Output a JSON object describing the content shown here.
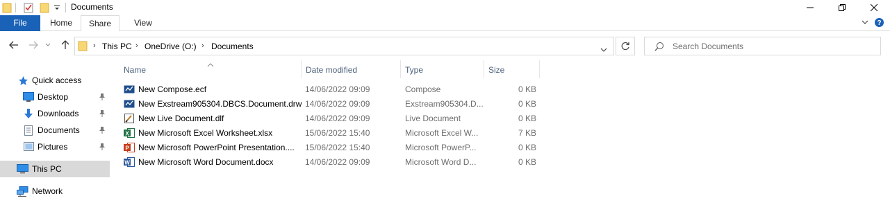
{
  "window": {
    "title": "Documents",
    "controls": {
      "minimize": "—",
      "maximize": "❐",
      "close": "✕"
    }
  },
  "ribbon": {
    "tabs": [
      "File",
      "Home",
      "Share",
      "View"
    ],
    "active_tab": "Share",
    "file_tab_color": "#1a62b8"
  },
  "address": {
    "segments": [
      "This PC",
      "OneDrive (O:)",
      "Documents"
    ],
    "search_placeholder": "Search Documents"
  },
  "sidebar": {
    "items": [
      {
        "label": "Quick access",
        "icon": "star-icon"
      },
      {
        "label": "Desktop",
        "icon": "desktop-icon",
        "pinned": true
      },
      {
        "label": "Downloads",
        "icon": "download-icon",
        "pinned": true
      },
      {
        "label": "Documents",
        "icon": "documents-icon",
        "pinned": true
      },
      {
        "label": "Pictures",
        "icon": "pictures-icon",
        "pinned": true
      },
      {
        "label": "This PC",
        "icon": "computer-icon",
        "selected": true
      },
      {
        "label": "Network",
        "icon": "network-icon"
      }
    ]
  },
  "columns": [
    "Name",
    "Date modified",
    "Type",
    "Size"
  ],
  "files": [
    {
      "name": "New Compose.ecf",
      "date": "14/06/2022 09:09",
      "type": "Compose",
      "size": "0 KB",
      "icon": "exstream-icon"
    },
    {
      "name": "New Exstream905304.DBCS.Document.drw",
      "date": "14/06/2022 09:09",
      "type": "Exstream905304.D...",
      "size": "0 KB",
      "icon": "exstream-icon"
    },
    {
      "name": "New Live Document.dlf",
      "date": "14/06/2022 09:09",
      "type": "Live Document",
      "size": "0 KB",
      "icon": "live-document-icon"
    },
    {
      "name": "New Microsoft Excel Worksheet.xlsx",
      "date": "15/06/2022 15:40",
      "type": "Microsoft Excel W...",
      "size": "7 KB",
      "icon": "excel-icon"
    },
    {
      "name": "New Microsoft PowerPoint Presentation....",
      "date": "15/06/2022 15:40",
      "type": "Microsoft PowerP...",
      "size": "0 KB",
      "icon": "powerpoint-icon"
    },
    {
      "name": "New Microsoft Word Document.docx",
      "date": "14/06/2022 09:09",
      "type": "Microsoft Word D...",
      "size": "0 KB",
      "icon": "word-icon"
    }
  ]
}
